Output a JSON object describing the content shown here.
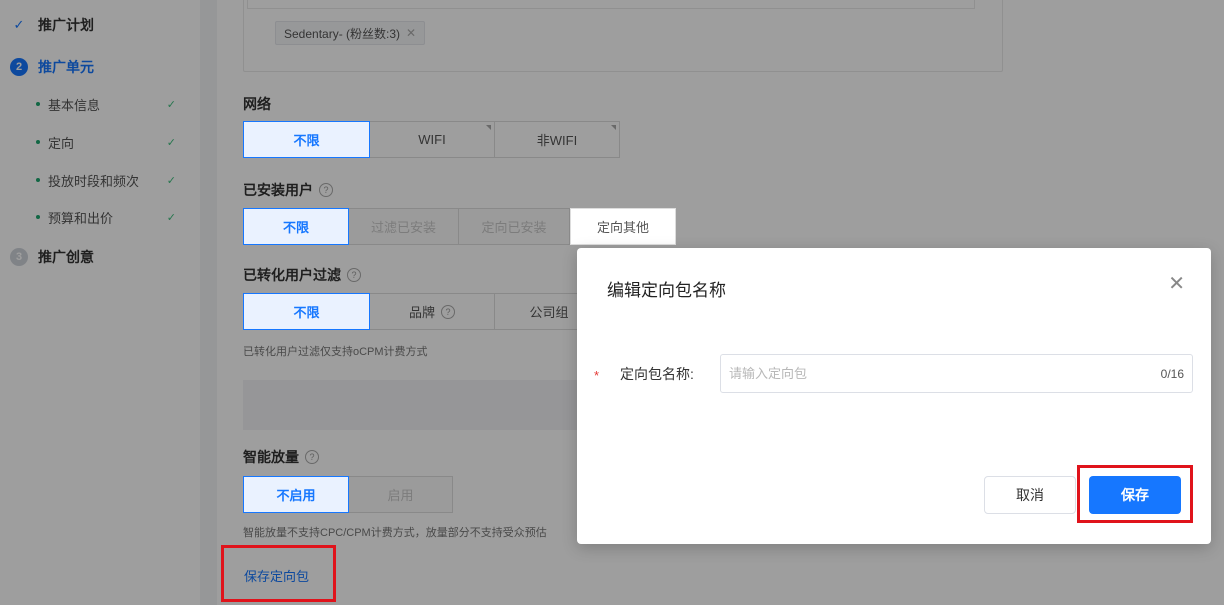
{
  "sidebar": {
    "steps": [
      {
        "label": "推广计划",
        "state": "done"
      },
      {
        "label": "推广单元",
        "state": "active",
        "num": "2"
      },
      {
        "label": "推广创意",
        "state": "pending",
        "num": "3"
      }
    ],
    "substeps": [
      {
        "label": "基本信息"
      },
      {
        "label": "定向"
      },
      {
        "label": "投放时段和频次"
      },
      {
        "label": "预算和出价"
      }
    ]
  },
  "form": {
    "audience_chip": "Sedentary- (粉丝数:3)",
    "network": {
      "title": "网络",
      "options": [
        "不限",
        "WIFI",
        "非WIFI"
      ]
    },
    "installed_users": {
      "title": "已安装用户",
      "options": [
        "不限",
        "过滤已安装",
        "定向已安装",
        "定向其他"
      ]
    },
    "converted_filter": {
      "title": "已转化用户过滤",
      "options": [
        "不限",
        "品牌",
        "公司组"
      ],
      "hint": "已转化用户过滤仅支持oCPM计费方式"
    },
    "smart_expand": {
      "title": "智能放量",
      "options": [
        "不启用",
        "启用"
      ],
      "hint": "智能放量不支持CPC/CPM计费方式，放量部分不支持受众预估"
    },
    "save_package_link": "保存定向包"
  },
  "modal": {
    "title": "编辑定向包名称",
    "required_mark": "*",
    "field_label": "定向包名称:",
    "placeholder": "请输入定向包",
    "counter": "0/16",
    "cancel_label": "取消",
    "save_label": "保存"
  },
  "colors": {
    "accent": "#1677ff",
    "highlight": "#e0131b",
    "success": "#3fbf7f"
  }
}
